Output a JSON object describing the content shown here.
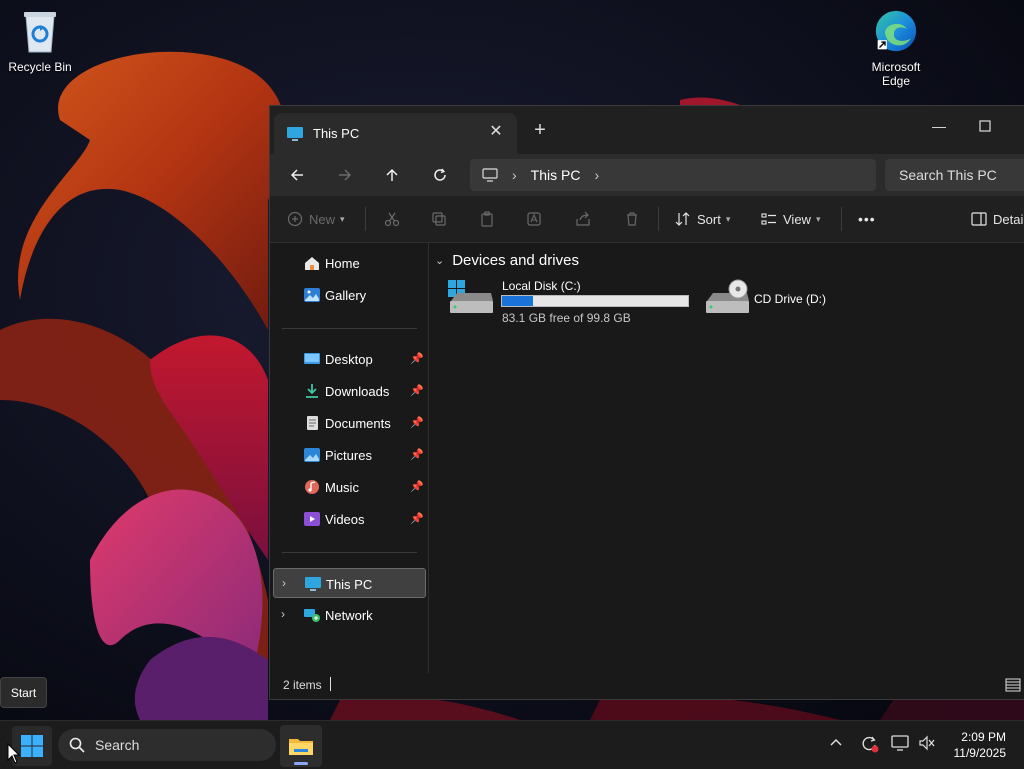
{
  "desktop": {
    "icons": [
      {
        "label": "Recycle Bin",
        "icon": "recycle-bin-icon"
      },
      {
        "label": "Microsoft\nEdge",
        "icon": "edge-icon"
      }
    ]
  },
  "explorer": {
    "tab": {
      "title": "This PC",
      "close": "✕"
    },
    "new_tab": "+",
    "window_controls": {
      "minimize": "—",
      "maximize": "☐"
    },
    "address": {
      "crumb": "This PC"
    },
    "search_placeholder": "Search This PC",
    "commands": {
      "new": "New",
      "sort": "Sort",
      "view": "View",
      "more": "•••",
      "details": "Detai"
    },
    "sidebar": {
      "home": "Home",
      "gallery": "Gallery",
      "quick": [
        {
          "label": "Desktop"
        },
        {
          "label": "Downloads"
        },
        {
          "label": "Documents"
        },
        {
          "label": "Pictures"
        },
        {
          "label": "Music"
        },
        {
          "label": "Videos"
        }
      ],
      "this_pc": "This PC",
      "network": "Network"
    },
    "group_title": "Devices and drives",
    "drives": [
      {
        "name": "Local Disk (C:)",
        "free_text": "83.1 GB free of 99.8 GB",
        "used_fraction": 0.167
      },
      {
        "name": "CD Drive (D:)"
      }
    ],
    "status": "2 items"
  },
  "taskbar": {
    "start_tooltip": "Start",
    "search_label": "Search",
    "time": "2:09 PM",
    "date": "11/9/2025"
  },
  "colors": {
    "accent": "#1a73d9",
    "window_bg": "#191919",
    "taskbar_bg": "#1c1c1c"
  }
}
